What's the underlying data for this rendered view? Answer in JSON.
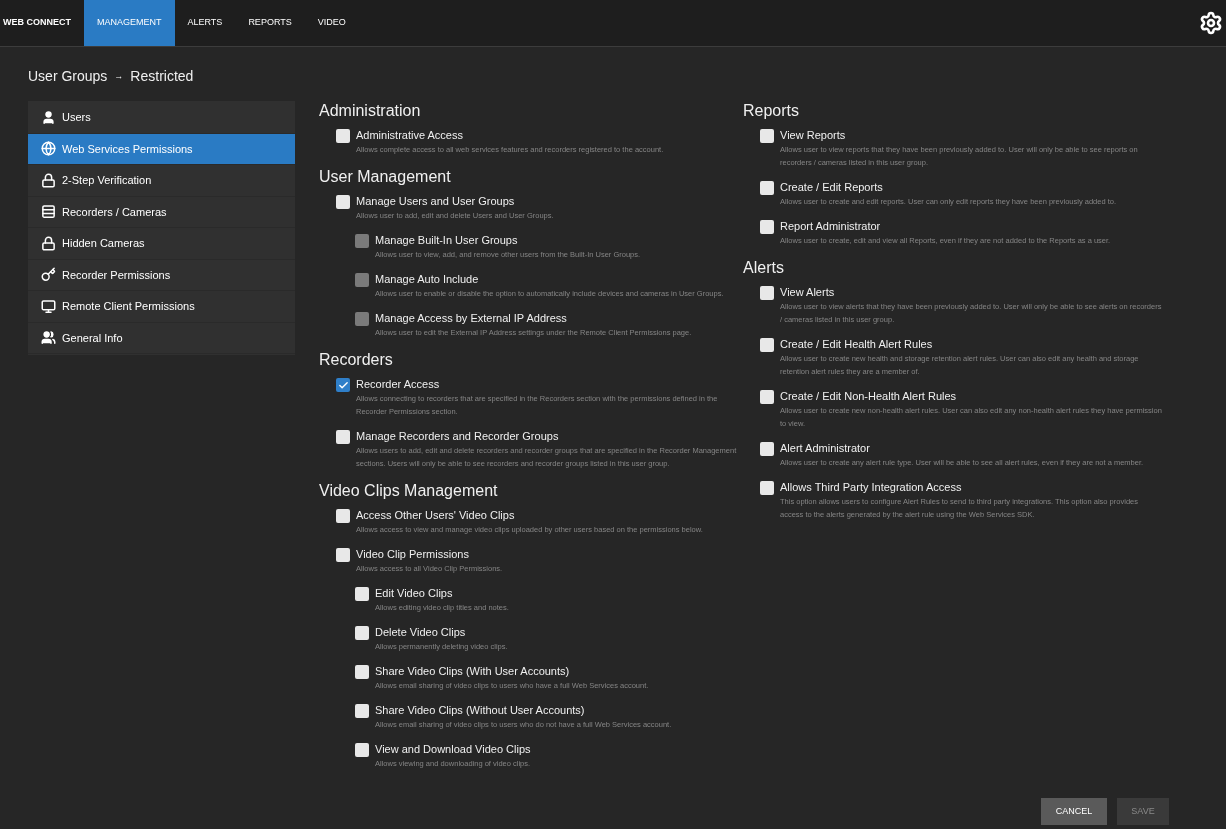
{
  "nav": {
    "brand": "WEB CONNECT",
    "tabs": [
      {
        "label": "MANAGEMENT",
        "selected": true
      },
      {
        "label": "ALERTS",
        "selected": false
      },
      {
        "label": "REPORTS",
        "selected": false
      },
      {
        "label": "VIDEO",
        "selected": false
      }
    ]
  },
  "breadcrumb": {
    "parent": "User Groups",
    "separator": "→",
    "current": "Restricted"
  },
  "sidebar": {
    "items": [
      {
        "label": "Users",
        "selected": false
      },
      {
        "label": "Web Services Permissions",
        "selected": true
      },
      {
        "label": "2-Step Verification",
        "selected": false
      },
      {
        "label": "Recorders / Cameras",
        "selected": false
      },
      {
        "label": "Hidden Cameras",
        "selected": false
      },
      {
        "label": "Recorder Permissions",
        "selected": false
      },
      {
        "label": "Remote Client Permissions",
        "selected": false
      },
      {
        "label": "General Info",
        "selected": false
      }
    ]
  },
  "columns": [
    [
      {
        "title": "Administration",
        "options": [
          {
            "label": "Administrative Access",
            "description": "Allows complete access to all web services features and recorders registered to the account.",
            "checked": false,
            "disabled": false
          }
        ]
      },
      {
        "title": "User Management",
        "options": [
          {
            "label": "Manage Users and User Groups",
            "description": "Allows user to add, edit and delete Users and User Groups.",
            "checked": false,
            "disabled": false,
            "children": [
              {
                "label": "Manage Built-In User Groups",
                "description": "Allows user to view, add, and remove other users from the Built-In User Groups.",
                "checked": false,
                "disabled": true
              },
              {
                "label": "Manage Auto Include",
                "description": "Allows user to enable or disable the option to automatically include devices and cameras in User Groups.",
                "checked": false,
                "disabled": true
              },
              {
                "label": "Manage Access by External IP Address",
                "description": "Allows user to edit the External IP Address settings under the Remote Client Permissions page.",
                "checked": false,
                "disabled": true
              }
            ]
          }
        ]
      },
      {
        "title": "Recorders",
        "options": [
          {
            "label": "Recorder Access",
            "description": "Allows connecting to recorders that are specified in the Recorders section with the permissions defined in the Recorder Permissions section.",
            "checked": true,
            "disabled": false
          },
          {
            "label": "Manage Recorders and Recorder Groups",
            "description": "Allows users to add, edit and delete recorders and recorder groups that are specified in the Recorder Management sections. Users will only be able to see recorders and recorder groups listed in this user group.",
            "checked": false,
            "disabled": false
          }
        ]
      },
      {
        "title": "Video Clips Management",
        "options": [
          {
            "label": "Access Other Users' Video Clips",
            "description": "Allows access to view and manage video clips uploaded by other users based on the permissions below.",
            "checked": false,
            "disabled": false
          },
          {
            "label": "Video Clip Permissions",
            "description": "Allows access to all Video Clip Permissions.",
            "checked": false,
            "disabled": false,
            "children": [
              {
                "label": "Edit Video Clips",
                "description": "Allows editing video clip titles and notes.",
                "checked": false,
                "disabled": false
              },
              {
                "label": "Delete Video Clips",
                "description": "Allows permanently deleting video clips.",
                "checked": false,
                "disabled": false
              },
              {
                "label": "Share Video Clips (With User Accounts)",
                "description": "Allows email sharing of video clips to users who have a full Web Services account.",
                "checked": false,
                "disabled": false
              },
              {
                "label": "Share Video Clips (Without User Accounts)",
                "description": "Allows email sharing of video clips to users who do not have a full Web Services account.",
                "checked": false,
                "disabled": false
              },
              {
                "label": "View and Download Video Clips",
                "description": "Allows viewing and downloading of video clips.",
                "checked": false,
                "disabled": false
              }
            ]
          }
        ]
      }
    ],
    [
      {
        "title": "Reports",
        "options": [
          {
            "label": "View Reports",
            "description": "Allows user to view reports that they have been previously added to. User will only be able to see reports on recorders / cameras listed in this user group.",
            "checked": false,
            "disabled": false
          },
          {
            "label": "Create / Edit Reports",
            "description": "Allows user to create and edit reports. User can only edit reports they have been previously added to.",
            "checked": false,
            "disabled": false
          },
          {
            "label": "Report Administrator",
            "description": "Allows user to create, edit and view all Reports, even if they are not added to the Reports as a user.",
            "checked": false,
            "disabled": false
          }
        ]
      },
      {
        "title": "Alerts",
        "options": [
          {
            "label": "View Alerts",
            "description": "Allows user to view alerts that they have been previously added to. User will only be able to see alerts on recorders / cameras listed in this user group.",
            "checked": false,
            "disabled": false
          },
          {
            "label": "Create / Edit Health Alert Rules",
            "description": "Allows user to create new health and storage retention alert rules. User can also edit any health and storage retention alert rules they are a member of.",
            "checked": false,
            "disabled": false
          },
          {
            "label": "Create / Edit Non-Health Alert Rules",
            "description": "Allows user to create new non-health alert rules. User can also edit any non-health alert rules they have permission to view.",
            "checked": false,
            "disabled": false
          },
          {
            "label": "Alert Administrator",
            "description": "Allows user to create any alert rule type. User will be able to see all alert rules, even if they are not a member.",
            "checked": false,
            "disabled": false
          },
          {
            "label": "Allows Third Party Integration Access",
            "description": "This option allows users to configure Alert Rules to send to third party integrations. This option also provides access to the alerts generated by the alert rule using the Web Services SDK.",
            "checked": false,
            "disabled": false
          }
        ]
      }
    ]
  ],
  "buttons": [
    {
      "label": "CANCEL",
      "disabled": false
    },
    {
      "label": "SAVE",
      "disabled": true
    }
  ]
}
